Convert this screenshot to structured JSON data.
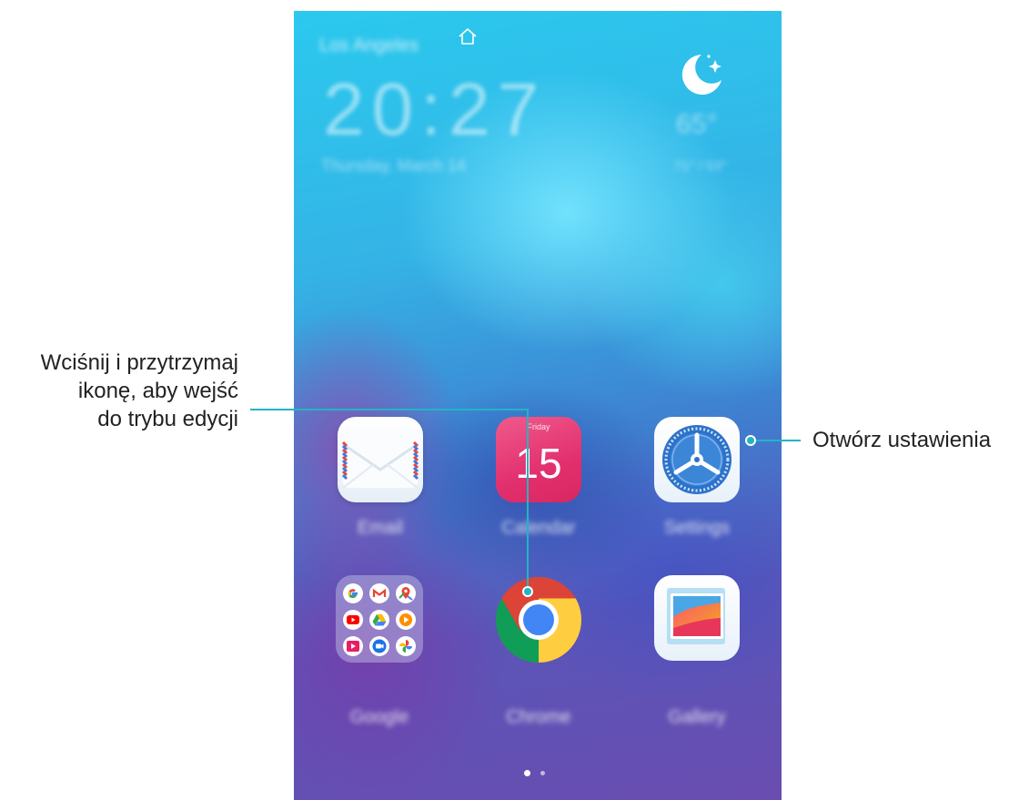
{
  "callouts": {
    "settings": "Otwórz ustawienia",
    "chrome_line1": "Wciśnij i przytrzymaj",
    "chrome_line2": "ikonę, aby wejść",
    "chrome_line3": "do trybu edycji"
  },
  "widget": {
    "city": "Los Angeles",
    "time": "20:27",
    "date": "Thursday, March 14",
    "temperature": "65°",
    "temp_range": "71° / 53°"
  },
  "calendar": {
    "weekday": "Friday",
    "day": "15"
  },
  "apps": {
    "email": "Email",
    "calendar": "Calendar",
    "settings": "Settings",
    "google": "Google",
    "chrome": "Chrome",
    "gallery": "Gallery"
  },
  "page_indicator": {
    "current": 1,
    "total": 2
  }
}
